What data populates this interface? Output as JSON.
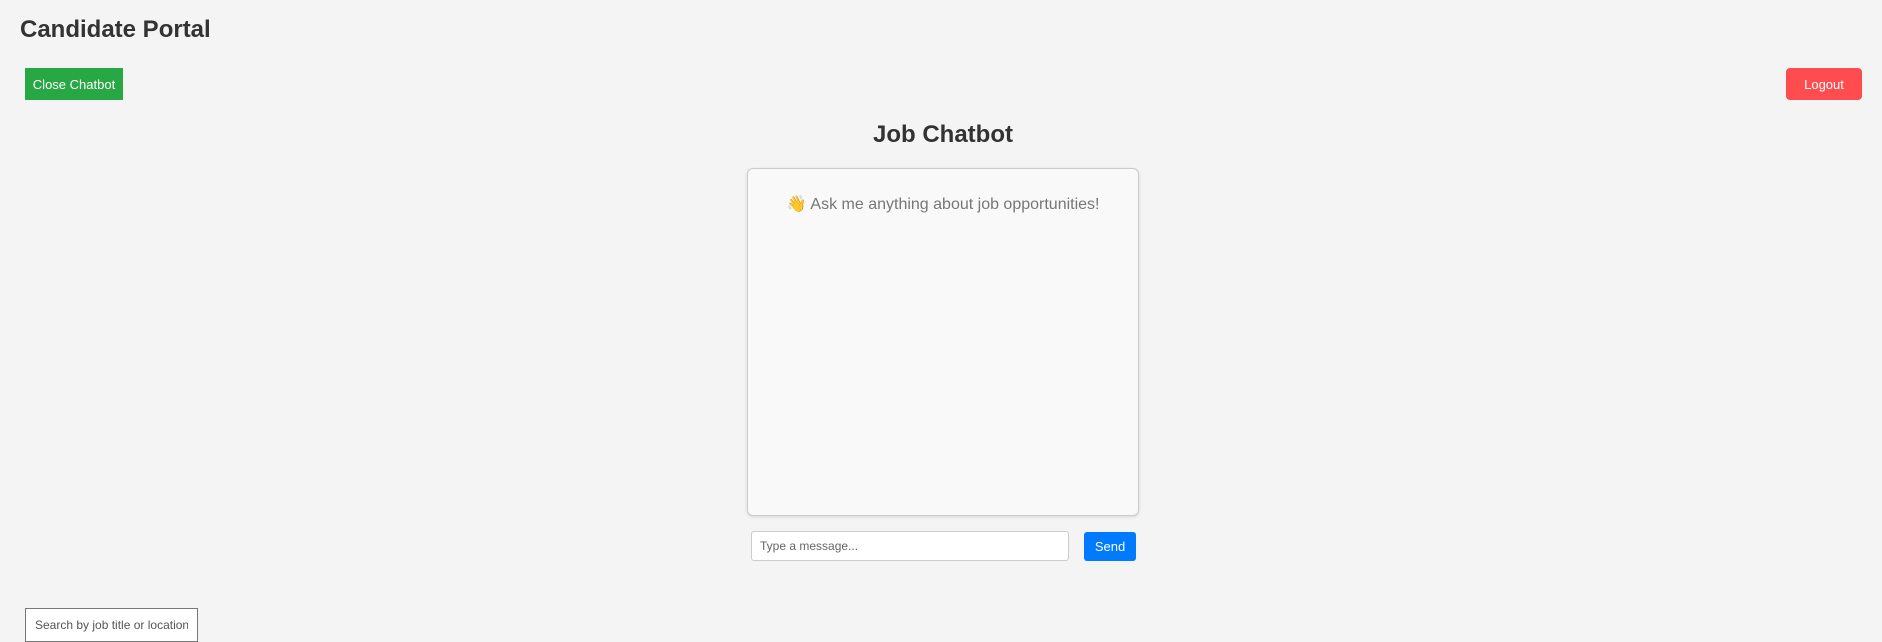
{
  "header": {
    "title": "Candidate Portal"
  },
  "toolbar": {
    "close_chatbot_label": "Close Chatbot",
    "logout_label": "Logout"
  },
  "chatbot": {
    "title": "Job Chatbot",
    "welcome_icon": "👋",
    "welcome_message": "Ask me anything about job opportunities!",
    "input_placeholder": "Type a message...",
    "input_value": "",
    "send_label": "Send"
  },
  "search": {
    "placeholder": "Search by job title or location",
    "value": ""
  },
  "colors": {
    "background": "#f4f4f4",
    "close_button": "#28a745",
    "logout_button": "#ff4d4f",
    "send_button": "#007bff",
    "chat_window": "#f9f9f9"
  }
}
